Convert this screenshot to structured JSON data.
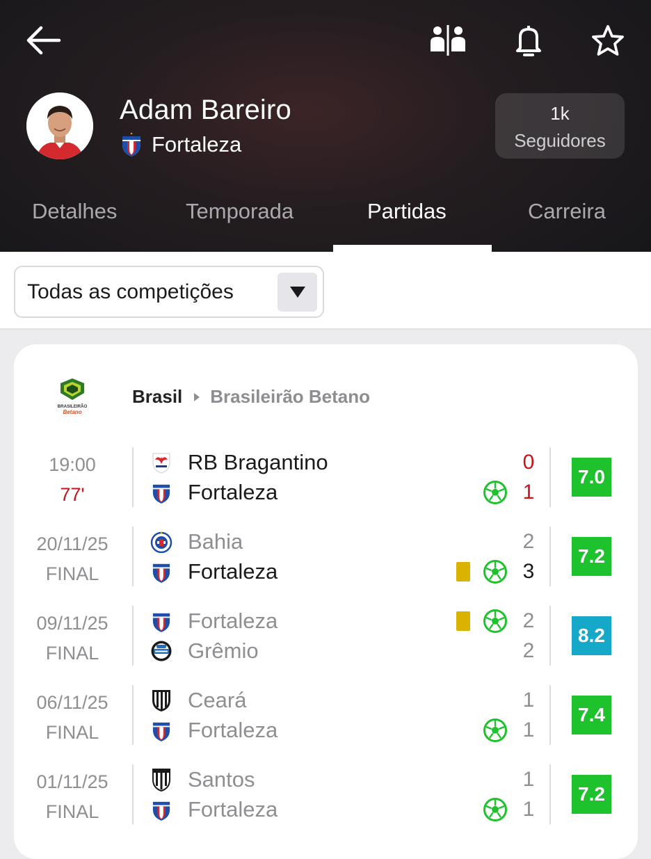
{
  "header": {
    "player_name": "Adam Bareiro",
    "team_name": "Fortaleza",
    "followers_count": "1k",
    "followers_label": "Seguidores",
    "icons": [
      "back-arrow-icon",
      "compare-icon",
      "bell-icon",
      "star-icon"
    ]
  },
  "tabs": [
    {
      "label": "Detalhes"
    },
    {
      "label": "Temporada"
    },
    {
      "label": "Partidas",
      "active": true
    },
    {
      "label": "Carreira"
    }
  ],
  "filter": {
    "selected": "Todas as competições"
  },
  "competition": {
    "country": "Brasil",
    "league": "Brasileirão Betano",
    "logo_text_1": "BRASILEIRÃO",
    "logo_text_2": "Betano"
  },
  "colors": {
    "rating_green": "#1dc22c",
    "rating_blue": "#16a8c9",
    "live_red": "#c8141d",
    "goal_green": "#1dc22c",
    "yellow_card": "#d9b300"
  },
  "matches": [
    {
      "time": "19:00",
      "status": "77'",
      "home": {
        "name": "RB Bragantino",
        "score": "0"
      },
      "away": {
        "name": "Fortaleza",
        "score": "1"
      },
      "rating": "7.0"
    },
    {
      "time": "20/11/25",
      "status": "FINAL",
      "home": {
        "name": "Bahia",
        "score": "2"
      },
      "away": {
        "name": "Fortaleza",
        "score": "3"
      },
      "rating": "7.2"
    },
    {
      "time": "09/11/25",
      "status": "FINAL",
      "home": {
        "name": "Fortaleza",
        "score": "2"
      },
      "away": {
        "name": "Grêmio",
        "score": "2"
      },
      "rating": "8.2"
    },
    {
      "time": "06/11/25",
      "status": "FINAL",
      "home": {
        "name": "Ceará",
        "score": "1"
      },
      "away": {
        "name": "Fortaleza",
        "score": "1"
      },
      "rating": "7.4"
    },
    {
      "time": "01/11/25",
      "status": "FINAL",
      "home": {
        "name": "Santos",
        "score": "1"
      },
      "away": {
        "name": "Fortaleza",
        "score": "1"
      },
      "rating": "7.2"
    }
  ]
}
